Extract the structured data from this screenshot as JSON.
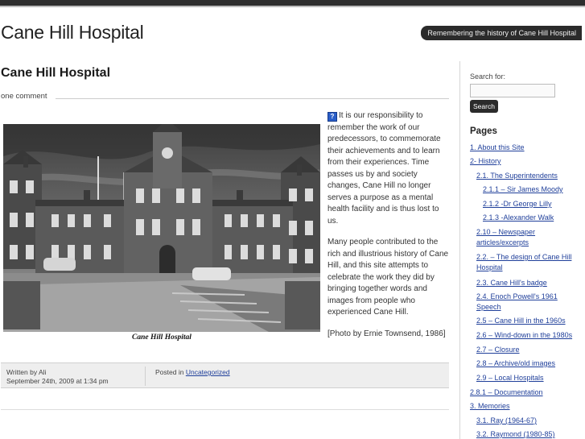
{
  "site": {
    "title": "Cane Hill Hospital",
    "tagline": "Remembering the history of Cane Hill Hospital"
  },
  "post": {
    "title": "Cane Hill Hospital",
    "comments_link": "one comment",
    "image_caption": "Cane Hill Hospital",
    "paragraph_1": "It is our responsibility to remember the work of our predecessors, to commemorate their achievements and to learn from their experiences. Time passes us by and society changes, Cane Hill no longer serves a purpose as a mental health facility and is thus lost to us.",
    "paragraph_2": "Many people contributed to the rich and illustrious history of Cane Hill, and this site attempts to celebrate the work they did by bringing together words and images from people who experienced Cane Hill.",
    "paragraph_3": "[Photo by Ernie Townsend, 1986]",
    "inline_icon": "question-mark-icon",
    "inline_icon_glyph": "?",
    "meta": {
      "written_by": "Written by Ali",
      "date": "September 24th, 2009 at 1:34 pm",
      "posted_in_prefix": "Posted in",
      "category": "Uncategorized"
    }
  },
  "sidebar": {
    "search_label": "Search for:",
    "search_value": "",
    "search_button": "Search",
    "pages_heading": "Pages",
    "pages": [
      "1. About this Site",
      "2- History",
      "2.1. The Superintendents",
      "2.1.1 – Sir James Moody",
      "2.1.2 -Dr George Lilly",
      "2.1.3 -Alexander Walk",
      "2.10 – Newspaper articles/excerpts",
      "2.2. – The design of Cane Hill Hospital",
      "2.3. Cane Hill's badge",
      "2.4. Enoch Powell's 1961 Speech",
      "2.5 – Cane Hill in the 1960s",
      "2.6 – Wind-down in the 1980s",
      "2.7 – Closure",
      "2.8 – Archive/old images",
      "2.9 – Local Hospitals",
      "2.8.1 – Documentation",
      "3. Memories",
      "3.1. Ray (1964-67)",
      "3.2. Raymond (1980-85)"
    ]
  },
  "colors": {
    "topbar": "#2e2e2e",
    "tagline_bg": "#2b2b2b",
    "link": "#1f3f9a",
    "meta_bg": "#eeeeee"
  }
}
